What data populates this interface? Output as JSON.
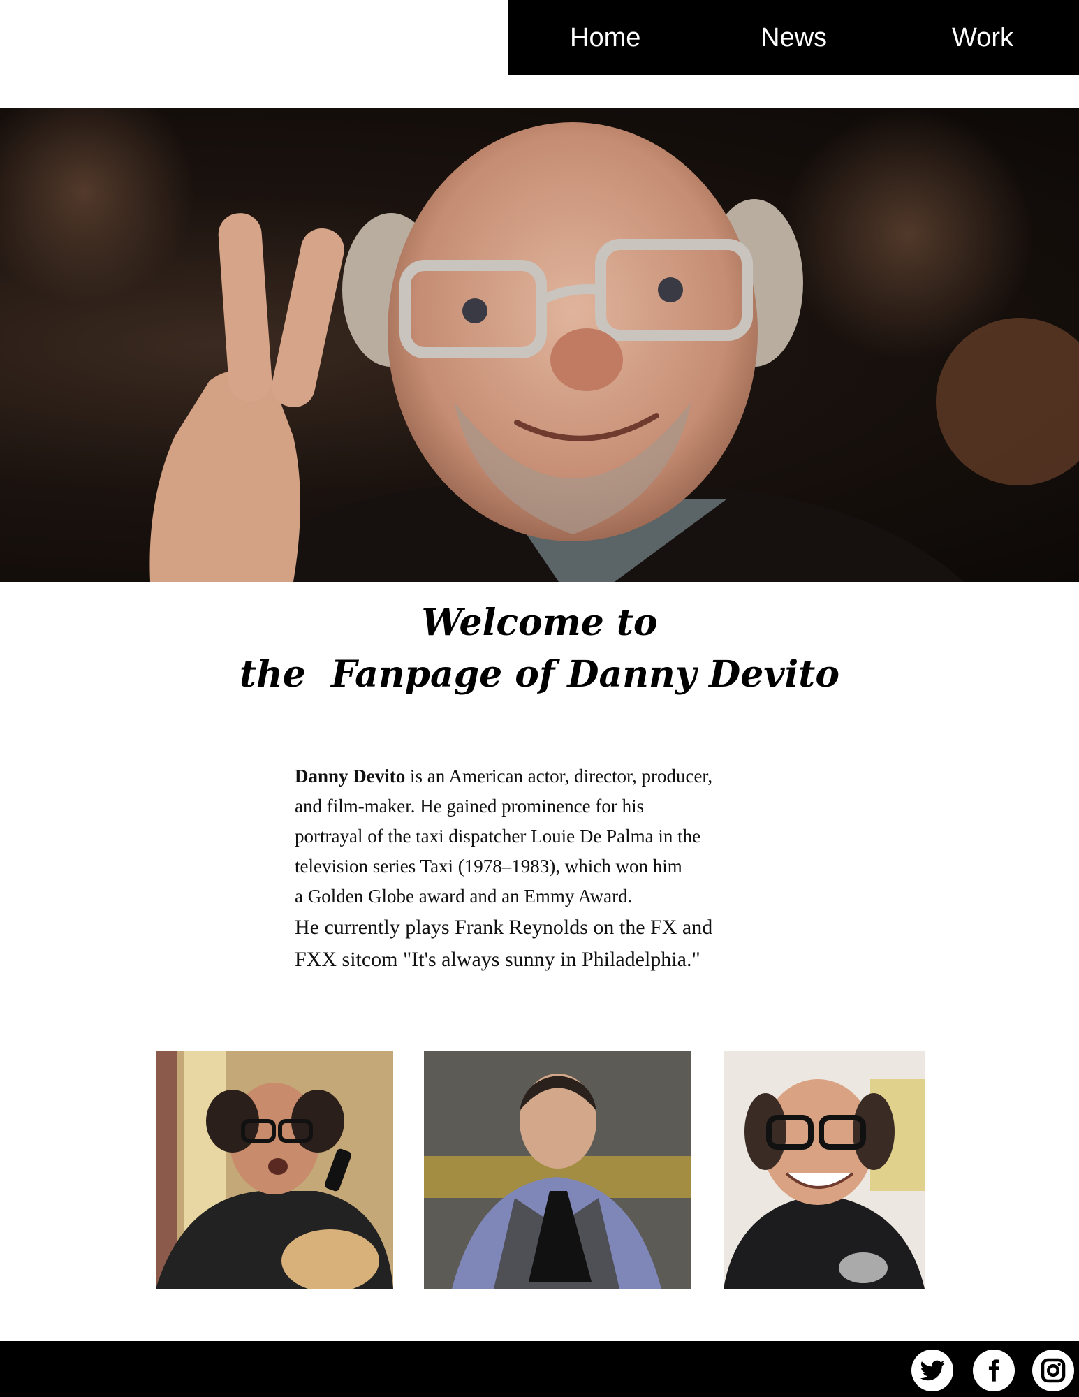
{
  "nav": {
    "items": [
      {
        "label": "Home"
      },
      {
        "label": "News"
      },
      {
        "label": "Work"
      }
    ]
  },
  "heading": {
    "line1": "Welcome to",
    "line2": "the  Fanpage of Danny Devito"
  },
  "bio": {
    "name": "Danny Devito",
    "line1_rest": " is an American actor, director, producer,",
    "line2": "and film-maker. He gained prominence for his",
    "line3": "portrayal of the taxi dispatcher Louie De Palma in the",
    "line4": "television series Taxi (1978–1983), which won him",
    "line5": "a Golden Globe award and an Emmy Award.",
    "line6": "He currently plays Frank Reynolds on the FX and",
    "line7": "FXX sitcom \"It's always sunny in Philadelphia.\""
  },
  "gallery": {
    "images": [
      {
        "icon": "photo-frank-reynolds"
      },
      {
        "icon": "photo-louie-de-palma"
      },
      {
        "icon": "photo-smiling-portrait"
      }
    ]
  },
  "footer": {
    "social": [
      {
        "icon": "twitter-icon"
      },
      {
        "icon": "facebook-icon"
      },
      {
        "icon": "instagram-icon"
      }
    ]
  },
  "colors": {
    "nav_bg": "#000000",
    "nav_text": "#ffffff",
    "footer_bg": "#000000",
    "page_bg": "#ffffff"
  }
}
